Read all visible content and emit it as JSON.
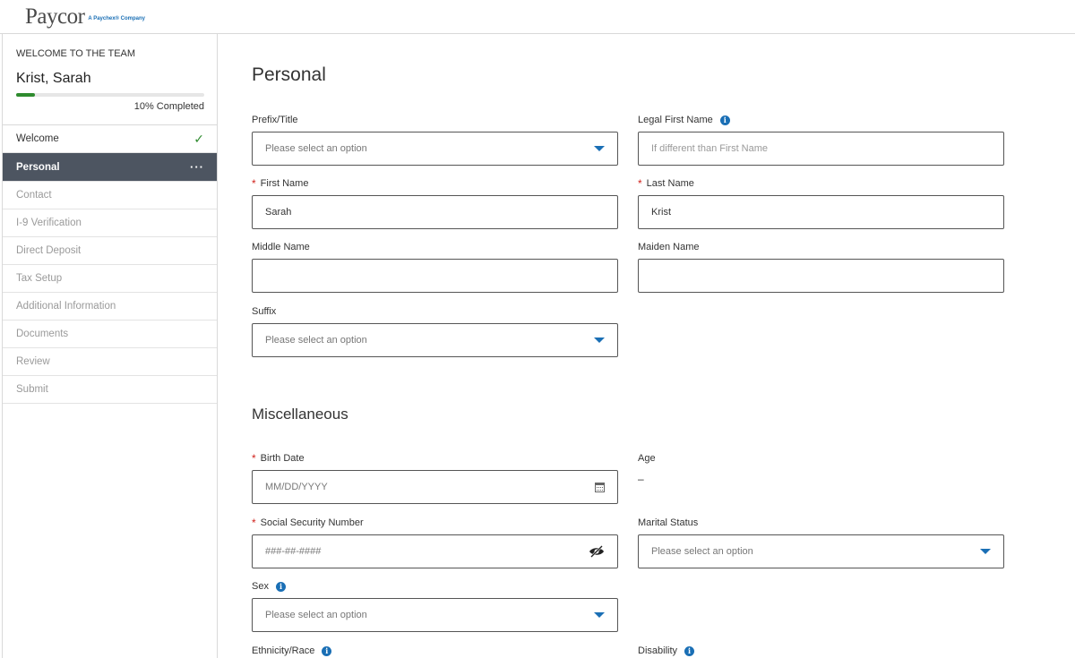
{
  "header": {
    "logo": "Paycor",
    "logo_sub": "A Paychex® Company"
  },
  "sidebar": {
    "welcome_label": "WELCOME TO THE TEAM",
    "employee_name": "Krist, Sarah",
    "progress_percent": 10,
    "progress_text": "10% Completed",
    "items": [
      {
        "label": "Welcome",
        "state": "done"
      },
      {
        "label": "Personal",
        "state": "active"
      },
      {
        "label": "Contact",
        "state": "pending"
      },
      {
        "label": "I-9 Verification",
        "state": "pending"
      },
      {
        "label": "Direct Deposit",
        "state": "pending"
      },
      {
        "label": "Tax Setup",
        "state": "pending"
      },
      {
        "label": "Additional Information",
        "state": "pending"
      },
      {
        "label": "Documents",
        "state": "pending"
      },
      {
        "label": "Review",
        "state": "pending"
      },
      {
        "label": "Submit",
        "state": "pending"
      }
    ]
  },
  "personal": {
    "title": "Personal",
    "prefix": {
      "label": "Prefix/Title",
      "placeholder": "Please select an option"
    },
    "legal_first_name": {
      "label": "Legal First Name",
      "placeholder": "If different than First Name"
    },
    "first_name": {
      "label": "First Name",
      "value": "Sarah"
    },
    "last_name": {
      "label": "Last Name",
      "value": "Krist"
    },
    "middle_name": {
      "label": "Middle Name",
      "value": ""
    },
    "maiden_name": {
      "label": "Maiden Name",
      "value": ""
    },
    "suffix": {
      "label": "Suffix",
      "placeholder": "Please select an option"
    }
  },
  "misc": {
    "title": "Miscellaneous",
    "birth_date": {
      "label": "Birth Date",
      "placeholder": "MM/DD/YYYY"
    },
    "age": {
      "label": "Age",
      "value": "–"
    },
    "ssn": {
      "label": "Social Security Number",
      "placeholder": "###-##-####"
    },
    "marital_status": {
      "label": "Marital Status",
      "placeholder": "Please select an option"
    },
    "sex": {
      "label": "Sex",
      "placeholder": "Please select an option"
    },
    "ethnicity": {
      "label": "Ethnicity/Race"
    },
    "disability": {
      "label": "Disability"
    }
  },
  "colors": {
    "accent": "#1a6fb5",
    "required": "#d0231d",
    "success": "#2e8b2e",
    "active_nav": "#4d5561"
  },
  "icons": {
    "info": "info-circle-icon",
    "dropdown": "caret-down-icon",
    "calendar": "calendar-icon",
    "ssn_toggle": "eye-slash-icon",
    "check": "check-icon",
    "more": "ellipsis-icon"
  }
}
